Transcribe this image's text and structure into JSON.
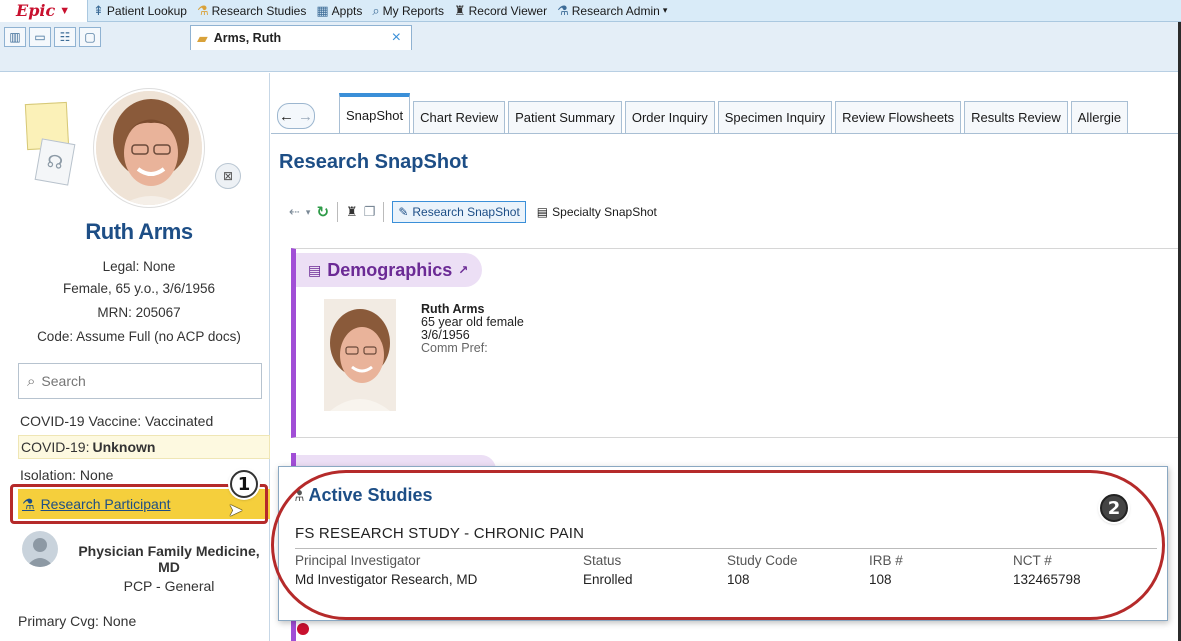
{
  "menubar": {
    "epic_label": "Epic",
    "items": [
      {
        "label": "Patient Lookup",
        "icon": "person-plus-icon"
      },
      {
        "label": "Research Studies",
        "icon": "research-icon"
      },
      {
        "label": "Appts",
        "icon": "appointments-icon"
      },
      {
        "label": "My Reports",
        "icon": "search-report-icon"
      },
      {
        "label": "Record Viewer",
        "icon": "binoculars-icon"
      },
      {
        "label": "Research Admin",
        "icon": "research-admin-icon"
      }
    ]
  },
  "workspace": {
    "patient_tab_label": "Arms, Ruth"
  },
  "sidebar": {
    "name": "Ruth Arms",
    "legal": "Legal: None",
    "demographics": "Female, 65 y.o., 3/6/1956",
    "mrn": "MRN: 205067",
    "code": "Code: Assume Full (no ACP docs)",
    "search_placeholder": "Search",
    "covid_vaccine": "COVID-19 Vaccine: Vaccinated",
    "covid_label": "COVID-19: ",
    "covid_value": "Unknown",
    "isolation": "Isolation: None",
    "research_participant": "Research Participant",
    "pcp_name": "Physician Family Medicine, MD",
    "pcp_role": "PCP - General",
    "primary_cvg": "Primary Cvg: None"
  },
  "activity_tabs": [
    {
      "label": "SnapShot",
      "active": true
    },
    {
      "label": "Chart Review"
    },
    {
      "label": "Patient Summary"
    },
    {
      "label": "Order Inquiry"
    },
    {
      "label": "Specimen Inquiry"
    },
    {
      "label": "Review Flowsheets"
    },
    {
      "label": "Results Review"
    },
    {
      "label": "Allergie"
    }
  ],
  "snapshot": {
    "title": "Research SnapShot",
    "research_snapshot_btn": "Research SnapShot",
    "specialty_snapshot_btn": "Specialty SnapShot"
  },
  "demographics": {
    "header": "Demographics",
    "name": "Ruth Arms",
    "age_sex": "65 year old female",
    "dob": "3/6/1956",
    "comm_pref": "Comm Pref:"
  },
  "active_studies": {
    "title": "Active Studies",
    "study_name": "FS RESEARCH STUDY - CHRONIC PAIN",
    "columns": [
      {
        "header": "Principal Investigator",
        "value": "Md Investigator Research, MD"
      },
      {
        "header": "Status",
        "value": "Enrolled"
      },
      {
        "header": "Study Code",
        "value": "108"
      },
      {
        "header": "IRB #",
        "value": "108"
      },
      {
        "header": "NCT #",
        "value": "132465798"
      }
    ]
  },
  "annotations": {
    "callout_1": "1",
    "callout_2": "2",
    "outline_color": "#b52a2a"
  },
  "colors": {
    "brand_red": "#c8102e",
    "accent_blue": "#1d4e86",
    "demographics_purple": "#a14ed6",
    "research_highlight": "#f5cf3c"
  }
}
